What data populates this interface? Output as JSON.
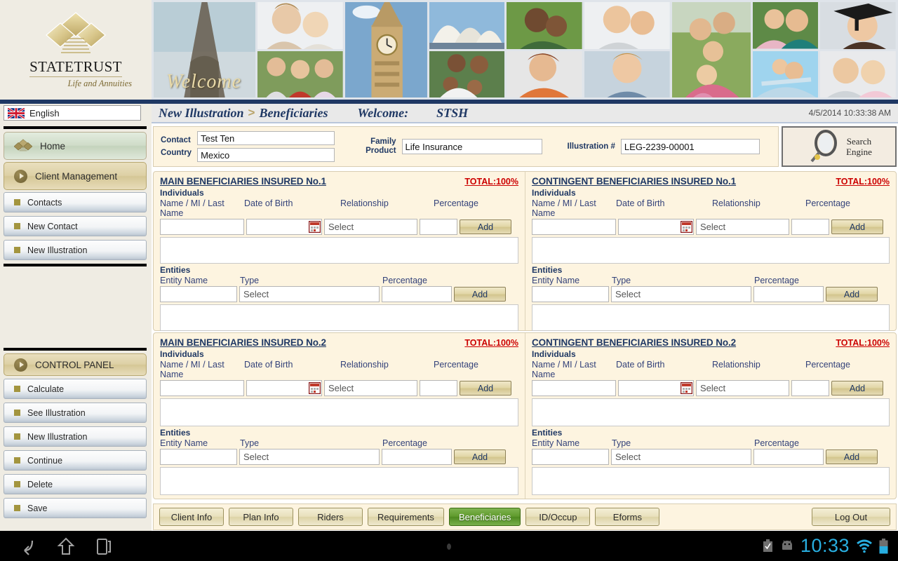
{
  "brand": {
    "name_part1": "S",
    "name_full": "STATETRUST",
    "tagline": "Life and Annuities",
    "logo_icon": "diamond-logo-icon"
  },
  "language": {
    "label": "English",
    "flag_icon": "uk-flag-icon"
  },
  "banner": {
    "welcome_text": "Welcome",
    "photos": [
      "eiffel-tower-photo",
      "mother-daughter-photo",
      "asian-family-photo",
      "big-ben-photo",
      "sydney-opera-house-photo",
      "couple-grass-photo",
      "african-family-photo",
      "woman-orange-photo",
      "woman-child-photo",
      "boy-portrait-photo",
      "family-park-photo",
      "mother-daughter-hug-photo",
      "father-flying-child-photo",
      "skyscraper-photo",
      "graduate-photo",
      "father-daughter-photo"
    ]
  },
  "sidebar": {
    "main": [
      {
        "label": "Home",
        "icon": "diamond-icon"
      },
      {
        "label": "Client Management",
        "icon": "play-circle-icon"
      }
    ],
    "sub": [
      {
        "label": "Contacts",
        "icon": "square-bullet-icon"
      },
      {
        "label": "New Contact",
        "icon": "square-bullet-icon"
      },
      {
        "label": "New Illustration",
        "icon": "square-bullet-icon"
      }
    ],
    "control_panel": {
      "label": "CONTROL PANEL",
      "icon": "play-circle-icon",
      "items": [
        {
          "label": "Calculate",
          "icon": "square-bullet-icon"
        },
        {
          "label": "See Illustration",
          "icon": "square-bullet-icon"
        },
        {
          "label": "New Illustration",
          "icon": "square-bullet-icon"
        },
        {
          "label": "Continue",
          "icon": "square-bullet-icon"
        },
        {
          "label": "Delete",
          "icon": "square-bullet-icon"
        },
        {
          "label": "Save",
          "icon": "square-bullet-icon"
        }
      ]
    }
  },
  "header": {
    "breadcrumb_parent": "New Illustration",
    "breadcrumb_separator": ">",
    "breadcrumb_current": "Beneficiaries",
    "welcome_label": "Welcome:",
    "user": "STSH",
    "timestamp": "4/5/2014 10:33:38 AM"
  },
  "contact_strip": {
    "contact_label": "Contact",
    "contact_value": "Test Ten",
    "country_label": "Country",
    "country_value": "Mexico",
    "family_label_line1": "Family",
    "family_label_line2": "Product",
    "family_value": "Life Insurance",
    "illustration_label": "Illustration #",
    "illustration_value": "LEG-2239-00001",
    "search_engine_line1": "Search",
    "search_engine_line2": "Engine",
    "search_icon": "magnifier-icon"
  },
  "field_labels": {
    "individuals": "Individuals",
    "entities": "Entities",
    "name": "Name / MI / Last Name",
    "dob": "Date of Birth",
    "relationship": "Relationship",
    "percentage": "Percentage",
    "entity_name": "Entity Name",
    "type": "Type",
    "select_placeholder": "Select",
    "add_label": "Add",
    "calendar_icon": "calendar-icon",
    "empty_value": ""
  },
  "panels": [
    {
      "title": "MAIN BENEFICIARIES INSURED No.1",
      "total": "TOTAL:100%"
    },
    {
      "title": "CONTINGENT BENEFICIARIES INSURED No.1",
      "total": "TOTAL:100%"
    },
    {
      "title": "MAIN BENEFICIARIES INSURED No.2",
      "total": "TOTAL:100%"
    },
    {
      "title": "CONTINGENT BENEFICIARIES INSURED No.2",
      "total": "TOTAL:100%"
    }
  ],
  "tabs": [
    {
      "label": "Client Info",
      "active": false
    },
    {
      "label": "Plan Info",
      "active": false
    },
    {
      "label": "Riders",
      "active": false
    },
    {
      "label": "Requirements",
      "active": false
    },
    {
      "label": "Beneficiaries",
      "active": true
    },
    {
      "label": "ID/Occup",
      "active": false
    },
    {
      "label": "Eforms",
      "active": false
    }
  ],
  "logout": {
    "label": "Log Out"
  },
  "android": {
    "back_icon": "back-arrow-icon",
    "home_icon": "home-icon",
    "recents_icon": "recent-apps-icon",
    "menu_dot_icon": "menu-dot-icon",
    "screenshot_icon": "screenshot-icon",
    "android_icon": "android-robot-icon",
    "clock": "10:33",
    "wifi_icon": "wifi-icon",
    "battery_icon": "battery-icon"
  },
  "colors": {
    "navy": "#1f3864",
    "cream": "#fdf4e0",
    "gold": "#b8a870",
    "red": "#cc0000",
    "green_active": "#5f9a2d",
    "android_blue": "#28aee0"
  }
}
